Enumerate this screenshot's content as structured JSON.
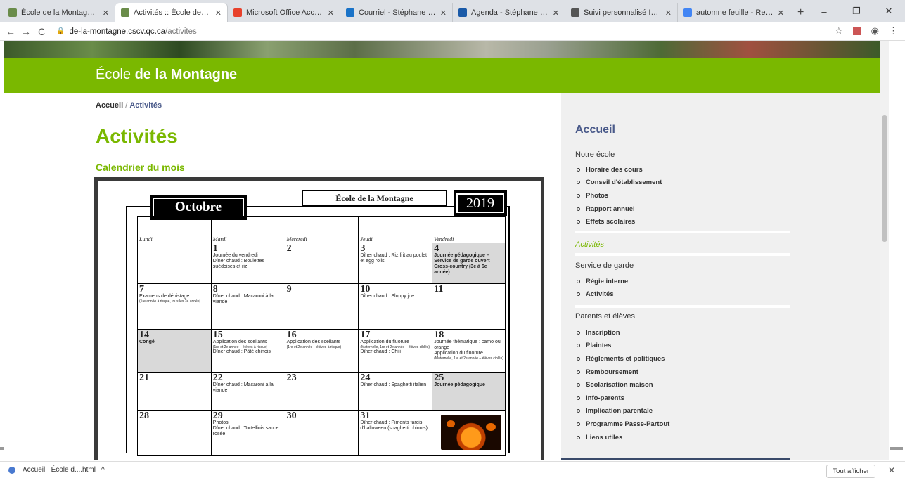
{
  "browser": {
    "tabs": [
      {
        "label": "École de la Montagne :: Commiss",
        "color": "#6a8c4a"
      },
      {
        "label": "Activités :: École de la Montagne",
        "color": "#6a8c4a"
      },
      {
        "label": "Microsoft Office Accueil",
        "color": "#e8412b"
      },
      {
        "label": "Courriel - Stéphane Mougeot - C",
        "color": "#1a73c8"
      },
      {
        "label": "Agenda - Stéphane Mougeot - C",
        "color": "#1a5aa8"
      },
      {
        "label": "Suivi personnalisé Internet - Bien",
        "color": "#555555"
      },
      {
        "label": "automne feuille - Recherche Goo",
        "color": "#4285f4"
      }
    ],
    "new_tab": "+",
    "window_controls": {
      "minimize": "–",
      "maximize": "❐",
      "close": "✕"
    },
    "nav": {
      "back": "←",
      "forward": "→",
      "reload": "C"
    },
    "url_host": "de-la-montagne.cscv.qc.ca",
    "url_path": "/activites"
  },
  "site": {
    "brand_prefix": "École ",
    "brand_bold": "de la Montagne",
    "breadcrumb": {
      "home": "Accueil",
      "sep": " / ",
      "current": "Activités"
    },
    "title": "Activités",
    "subtitle": "Calendrier du mois"
  },
  "calendar": {
    "month": "Octobre",
    "school": "École de la Montagne",
    "year": "2019",
    "days": [
      "Lundi",
      "Mardi",
      "Mercredi",
      "Jeudi",
      "Vendredi"
    ],
    "w1": {
      "tue_n": "1",
      "tue_t1": "Journée du vendredi",
      "tue_t2": "Dîner chaud : Boulettes suédoises et riz",
      "wed_n": "2",
      "thu_n": "3",
      "thu_t1": "Dîner chaud : Riz frit au poulet et egg rolls",
      "fri_n": "4",
      "fri_t1": "Journée pédagogique – Service de garde ouvert",
      "fri_t2": "Cross-country (3e à 6e année)"
    },
    "w2": {
      "mon_n": "7",
      "mon_t1": "Examens de dépistage",
      "mon_t2": "(1re année à risque, tous les 2e année)",
      "tue_n": "8",
      "tue_t1": "Dîner chaud : Macaroni à la viande",
      "wed_n": "9",
      "thu_n": "10",
      "thu_t1": "Dîner chaud : Sloppy joe",
      "fri_n": "11"
    },
    "w3": {
      "mon_n": "14",
      "mon_t1": "Congé",
      "tue_n": "15",
      "tue_t1": "Application des scellants",
      "tue_t2": "(1re et 2e année – élèves à risque)",
      "tue_t3": "Dîner chaud : Pâté chinois",
      "wed_n": "16",
      "wed_t1": "Application des scellants",
      "wed_t2": "(1re et 2e année – élèves à risque)",
      "thu_n": "17",
      "thu_t1": "Application du fluorure",
      "thu_t2": "(Maternelle, 1re et 2e année – élèves ciblés)",
      "thu_t3": "Dîner chaud : Chili",
      "fri_n": "18",
      "fri_t1": "Journée thématique : camo ou orange",
      "fri_t2": "Application du fluorure",
      "fri_t3": "(Maternelle, 1re et 2e année – élèves ciblés)"
    },
    "w4": {
      "mon_n": "21",
      "tue_n": "22",
      "tue_t1": "Dîner chaud : Macaroni à la viande",
      "wed_n": "23",
      "thu_n": "24",
      "thu_t1": "Dîner chaud : Spaghetti italien",
      "fri_n": "25",
      "fri_t1": "Journée pédagogique"
    },
    "w5": {
      "mon_n": "28",
      "tue_n": "29",
      "tue_t1": "Photos",
      "tue_t2": "Dîner chaud : Tortellinis sauce rosée",
      "wed_n": "30",
      "thu_n": "31",
      "thu_t1": "Dîner chaud : Piments farcis d'halloween (spaghetti chinois)"
    }
  },
  "sidebar": {
    "title": "Accueil",
    "sections": [
      {
        "heading": "Notre école",
        "items": [
          "Horaire des cours",
          "Conseil d'établissement",
          "Photos",
          "Rapport annuel",
          "Effets scolaires"
        ]
      },
      {
        "heading": "Service de garde",
        "items": [
          "Régie interne",
          "Activités"
        ]
      },
      {
        "heading": "Parents et élèves",
        "items": [
          "Inscription",
          "Plaintes",
          "Règlements et politiques",
          "Remboursement",
          "Scolarisation maison",
          "Info-parents",
          "Implication parentale",
          "Programme Passe-Partout",
          "Liens utiles"
        ]
      }
    ],
    "active_link": "Activités"
  },
  "downloads": {
    "item": "Accueil   École d....html",
    "chevron": "^",
    "show_all": "Tout afficher",
    "close": "✕"
  }
}
